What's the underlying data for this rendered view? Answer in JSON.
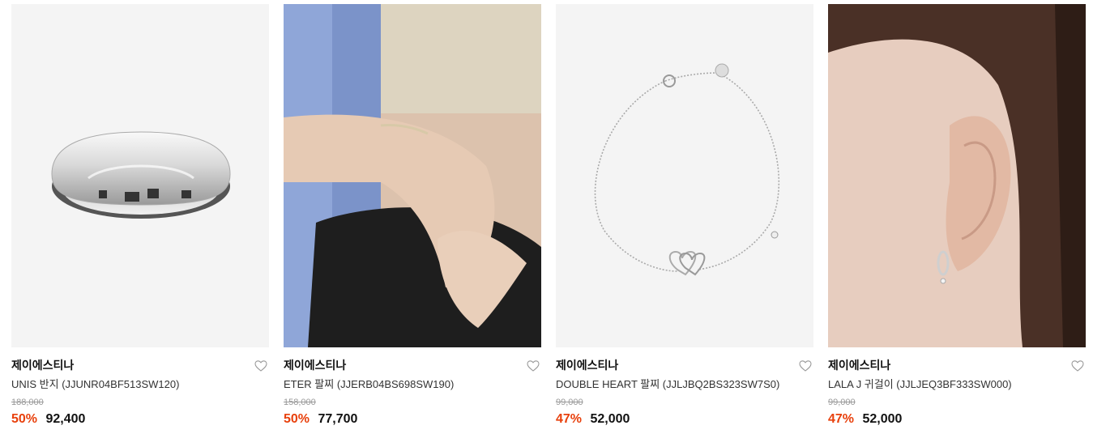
{
  "products": [
    {
      "brand": "제이에스티나",
      "name": "UNIS 반지 (JJUNR04BF513SW120)",
      "original_price": "188,000",
      "discount": "50%",
      "price": "92,400",
      "image": "silver-ring"
    },
    {
      "brand": "제이에스티나",
      "name": "ETER 팔찌 (JJERB04BS698SW190)",
      "original_price": "158,000",
      "discount": "50%",
      "price": "77,700",
      "image": "bracelet-on-wrist-photo"
    },
    {
      "brand": "제이에스티나",
      "name": "DOUBLE HEART 팔찌 (JJLJBQ2BS323SW7S0)",
      "original_price": "99,000",
      "discount": "47%",
      "price": "52,000",
      "image": "double-heart-bracelet"
    },
    {
      "brand": "제이에스티나",
      "name": "LALA J 귀걸이 (JJLJEQ3BF333SW000)",
      "original_price": "99,000",
      "discount": "47%",
      "price": "52,000",
      "image": "earring-on-ear-photo"
    }
  ],
  "icons": {
    "wishlist": "heart-outline-icon"
  },
  "colors": {
    "discount": "#e8400c",
    "price": "#111111",
    "original_price": "#999999"
  }
}
